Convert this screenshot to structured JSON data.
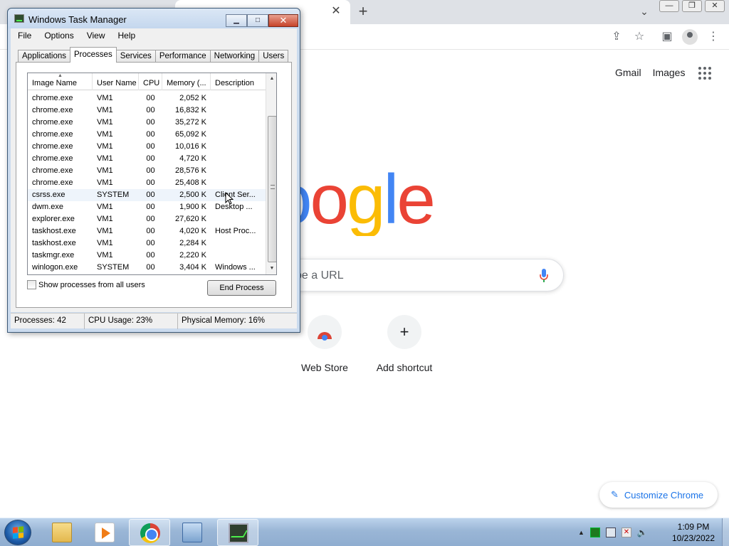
{
  "chrome": {
    "tab_close": "✕",
    "new_tab": "+",
    "links": [
      "Gmail",
      "Images"
    ],
    "search_placeholder": "pe a URL",
    "shortcuts": [
      {
        "label": "Web Store"
      },
      {
        "label": "Add shortcut",
        "glyph": "+"
      }
    ],
    "customize_label": "Customize Chrome",
    "logo_text": "oogle"
  },
  "task_manager": {
    "title": "Windows Task Manager",
    "menu": [
      "File",
      "Options",
      "View",
      "Help"
    ],
    "tabs": [
      "Applications",
      "Processes",
      "Services",
      "Performance",
      "Networking",
      "Users"
    ],
    "active_tab": "Processes",
    "columns": [
      "Image Name",
      "User Name",
      "CPU",
      "Memory (...",
      "Description"
    ],
    "processes": [
      {
        "name": "chrome.exe",
        "user": "VM1",
        "cpu": "00",
        "mem": "2,052 K",
        "desc": ""
      },
      {
        "name": "chrome.exe",
        "user": "VM1",
        "cpu": "00",
        "mem": "16,832 K",
        "desc": ""
      },
      {
        "name": "chrome.exe",
        "user": "VM1",
        "cpu": "00",
        "mem": "35,272 K",
        "desc": ""
      },
      {
        "name": "chrome.exe",
        "user": "VM1",
        "cpu": "00",
        "mem": "65,092 K",
        "desc": ""
      },
      {
        "name": "chrome.exe",
        "user": "VM1",
        "cpu": "00",
        "mem": "10,016 K",
        "desc": ""
      },
      {
        "name": "chrome.exe",
        "user": "VM1",
        "cpu": "00",
        "mem": "4,720 K",
        "desc": ""
      },
      {
        "name": "chrome.exe",
        "user": "VM1",
        "cpu": "00",
        "mem": "28,576 K",
        "desc": ""
      },
      {
        "name": "chrome.exe",
        "user": "VM1",
        "cpu": "00",
        "mem": "25,408 K",
        "desc": ""
      },
      {
        "name": "csrss.exe",
        "user": "SYSTEM",
        "cpu": "00",
        "mem": "2,500 K",
        "desc": "Client Ser..."
      },
      {
        "name": "dwm.exe",
        "user": "VM1",
        "cpu": "00",
        "mem": "1,900 K",
        "desc": "Desktop ..."
      },
      {
        "name": "explorer.exe",
        "user": "VM1",
        "cpu": "00",
        "mem": "27,620 K",
        "desc": ""
      },
      {
        "name": "taskhost.exe",
        "user": "VM1",
        "cpu": "00",
        "mem": "4,020 K",
        "desc": "Host Proc..."
      },
      {
        "name": "taskhost.exe",
        "user": "VM1",
        "cpu": "00",
        "mem": "2,284 K",
        "desc": ""
      },
      {
        "name": "taskmgr.exe",
        "user": "VM1",
        "cpu": "00",
        "mem": "2,220 K",
        "desc": ""
      },
      {
        "name": "winlogon.exe",
        "user": "SYSTEM",
        "cpu": "00",
        "mem": "3,404 K",
        "desc": "Windows ..."
      }
    ],
    "show_all_label": "Show processes from all users",
    "end_process_label": "End Process",
    "status": {
      "processes": "Processes: 42",
      "cpu": "CPU Usage: 23%",
      "memory": "Physical Memory: 16%"
    }
  },
  "taskbar": {
    "time": "1:09 PM",
    "date": "10/23/2022",
    "tray_arrow": "▲"
  }
}
